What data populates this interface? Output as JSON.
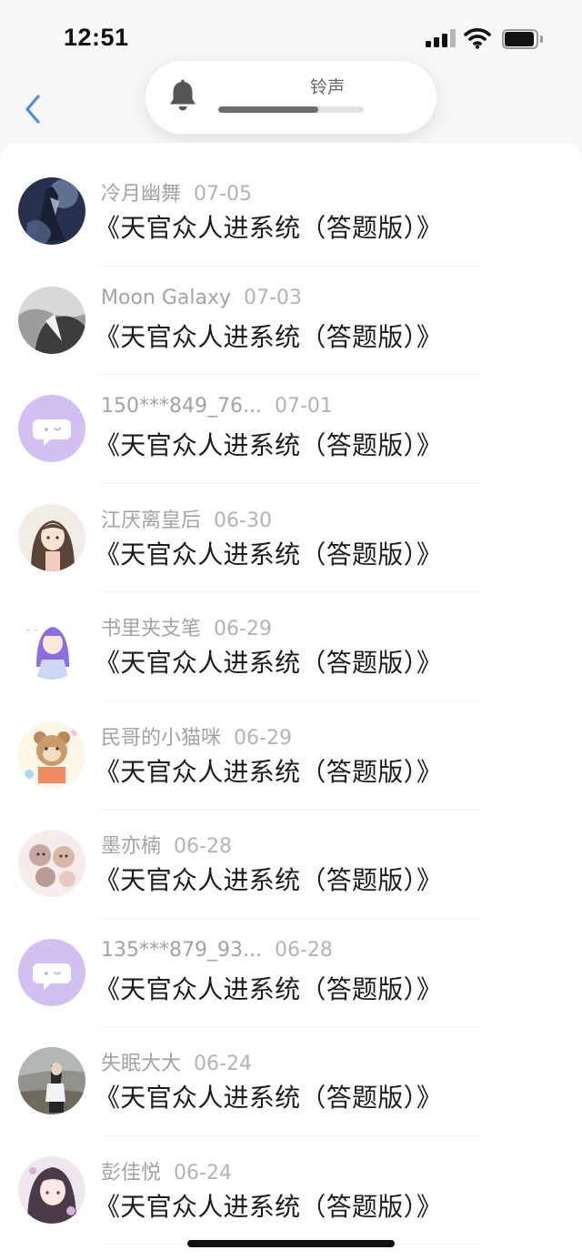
{
  "status_bar": {
    "time": "12:51"
  },
  "volume_hud": {
    "label": "铃声",
    "level": 0.69
  },
  "messages": [
    {
      "author": "冷月幽舞",
      "date": "07-05",
      "title": "《天官众人进系统（答题版）》",
      "avatar": "photo-night"
    },
    {
      "author": "Moon Galaxy",
      "date": "07-03",
      "title": "《天官众人进系统（答题版）》",
      "avatar": "photo-grey"
    },
    {
      "author": "150***849_76...",
      "date": "07-01",
      "title": "《天官众人进系统（答题版）》",
      "avatar": "default-chat"
    },
    {
      "author": "江厌离皇后",
      "date": "06-30",
      "title": "《天官众人进系统（答题版）》",
      "avatar": "anime-girl"
    },
    {
      "author": "书里夹支笔",
      "date": "06-29",
      "title": "《天官众人进系统（答题版）》",
      "avatar": "anime-purple"
    },
    {
      "author": "民哥的小猫咪",
      "date": "06-29",
      "title": "《天官众人进系统（答题版）》",
      "avatar": "cartoon-bear"
    },
    {
      "author": "墨亦楠",
      "date": "06-28",
      "title": "《天官众人进系统（答题版）》",
      "avatar": "cartoon-pink"
    },
    {
      "author": "135***879_93...",
      "date": "06-28",
      "title": "《天官众人进系统（答题版）》",
      "avatar": "default-chat"
    },
    {
      "author": "失眠大大",
      "date": "06-24",
      "title": "《天官众人进系统（答题版）》",
      "avatar": "photo-beach"
    },
    {
      "author": "彭佳悦",
      "date": "06-24",
      "title": "《天官众人进系统（答题版）》",
      "avatar": "anime-portrait"
    }
  ],
  "colors": {
    "accent": "#4a90e2",
    "default_avatar": "#d2c0f3"
  }
}
